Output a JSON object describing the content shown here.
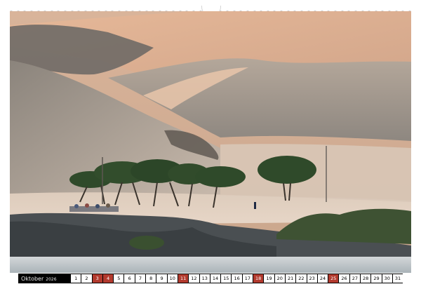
{
  "calendar": {
    "month": "Oktober",
    "year": "2026",
    "days": [
      "1",
      "2",
      "3",
      "4",
      "5",
      "6",
      "7",
      "8",
      "9",
      "10",
      "11",
      "12",
      "13",
      "14",
      "15",
      "16",
      "17",
      "18",
      "19",
      "20",
      "21",
      "22",
      "23",
      "24",
      "25",
      "26",
      "27",
      "28",
      "29",
      "30",
      "31"
    ],
    "highlighted_days": [
      "3",
      "4",
      "11",
      "18",
      "25"
    ]
  },
  "colors": {
    "sand_light": "#e8c4a8",
    "sand_shadow": "#8f8a84",
    "tree_green": "#2f4a2a",
    "rock": "#4a4f52",
    "water": "#c5ccd0",
    "highlight_day": "#b23a2e"
  }
}
